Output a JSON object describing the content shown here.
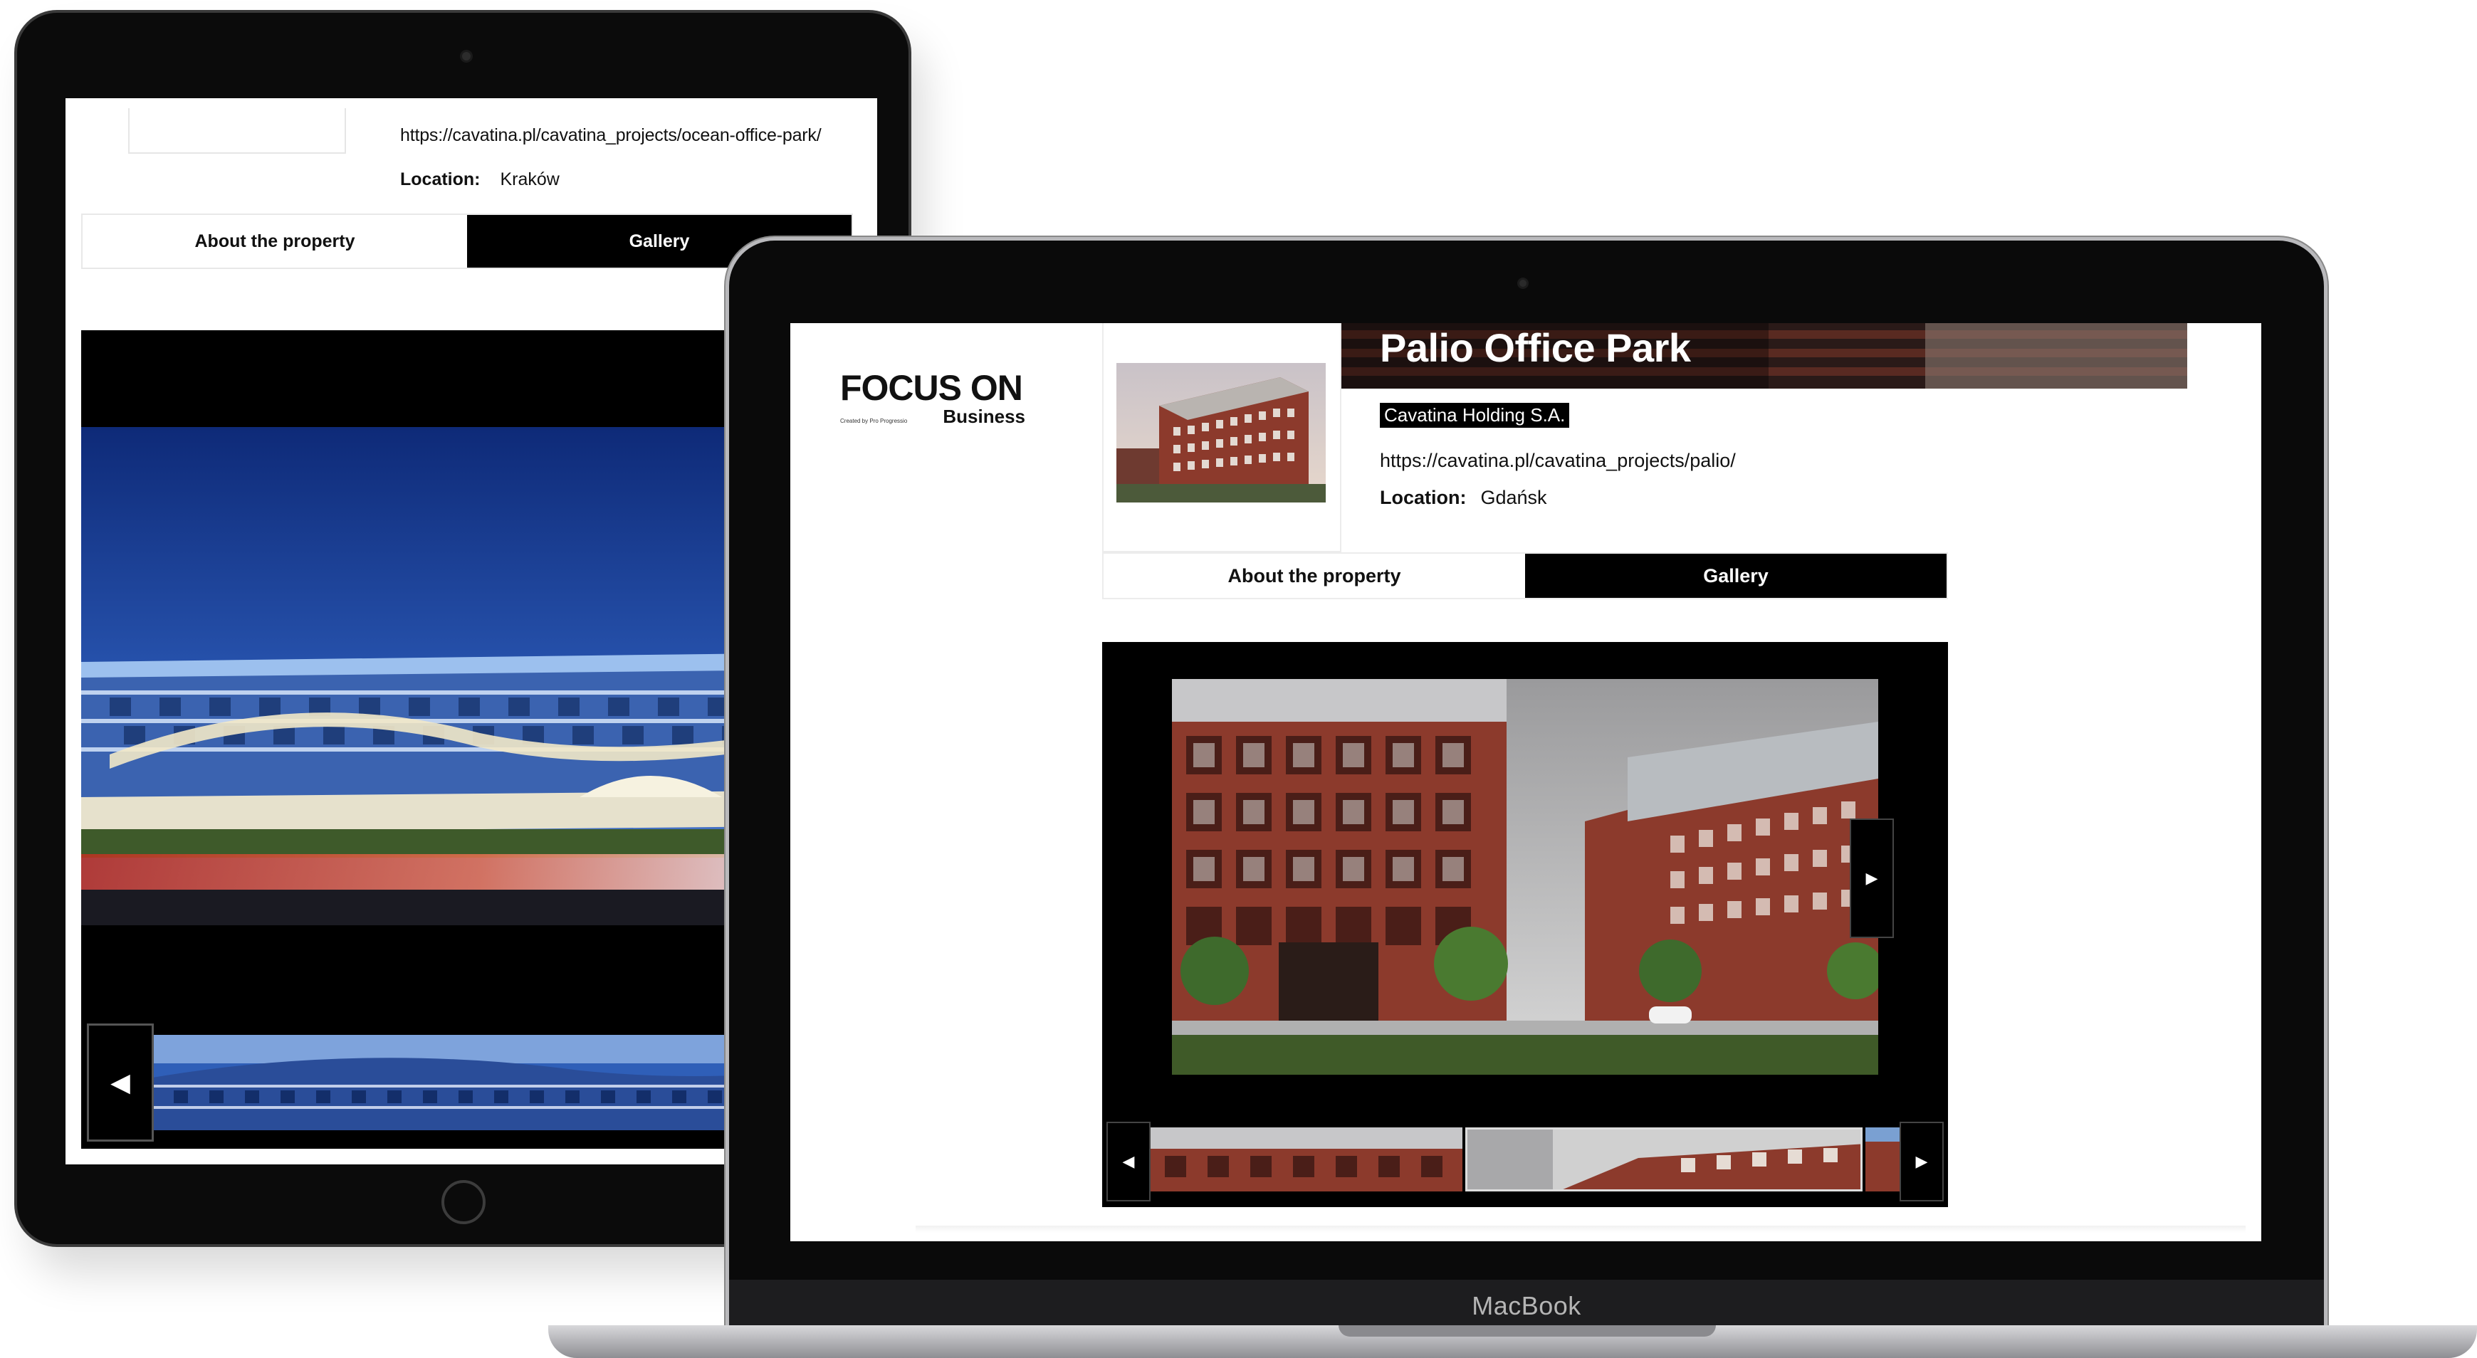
{
  "tablet": {
    "url": "https://cavatina.pl/cavatina_projects/ocean-office-park/",
    "location_label": "Location:",
    "location_value": "Kraków",
    "tabs": [
      "About the property",
      "Gallery"
    ],
    "prev_arrow": "◀"
  },
  "laptop": {
    "logo": {
      "main": "FOCUS ON",
      "small": "Created by Pro Progressio",
      "sub": "Business"
    },
    "title": "Palio Office Park",
    "company": "Cavatina Holding S.A.",
    "url": "https://cavatina.pl/cavatina_projects/palio/",
    "location_label": "Location:",
    "location_value": "Gdańsk",
    "tabs": [
      "About the property",
      "Gallery"
    ],
    "next_arrow": "▶",
    "prev_arrow": "◀",
    "brand_label": "MacBook"
  },
  "colors": {
    "brick": "#8c3a2c",
    "sky": "#1c3c8c",
    "glass": "#7fa3d6",
    "black": "#000000",
    "grass": "#4e6a2c"
  }
}
